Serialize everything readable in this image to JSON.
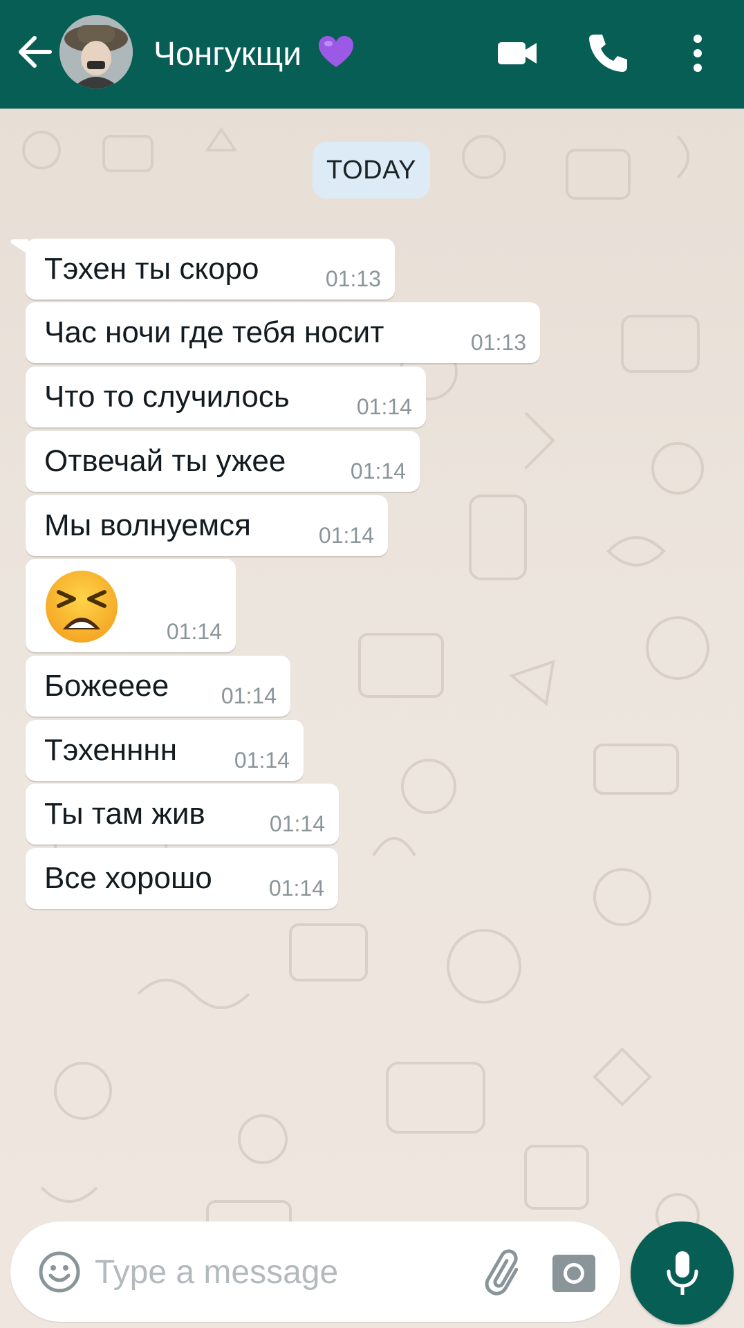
{
  "header": {
    "contact_name": "Чонгукщи",
    "name_emoji": "purple-heart-icon",
    "actions": [
      "back-arrow-icon",
      "video-call-icon",
      "voice-call-icon",
      "more-options-icon"
    ],
    "color": "#075e54"
  },
  "chat": {
    "date_chip": "TODAY",
    "messages": [
      {
        "text": "Тэхен ты скоро",
        "time": "01:13"
      },
      {
        "text": "Час ночи где тебя носит",
        "time": "01:13"
      },
      {
        "text": "Что то случилось",
        "time": "01:14"
      },
      {
        "text": "Отвечай ты ужее",
        "time": "01:14"
      },
      {
        "text": "Мы волнуемся",
        "time": "01:14"
      },
      {
        "emoji": "tired-face-emoji",
        "time": "01:14"
      },
      {
        "text": "Божееее",
        "time": "01:14"
      },
      {
        "text": "Тэхенннн",
        "time": "01:14"
      },
      {
        "text": "Ты там жив",
        "time": "01:14"
      },
      {
        "text": "Все хорошо",
        "time": "01:14"
      }
    ]
  },
  "composer": {
    "placeholder": "Type a message",
    "value": "",
    "icons": [
      "emoji-icon",
      "attach-icon",
      "camera-icon",
      "mic-icon"
    ]
  },
  "colors": {
    "header": "#075e54",
    "bubble": "#ffffff",
    "date_chip": "#dcebf5",
    "mic_button": "#075e54"
  }
}
